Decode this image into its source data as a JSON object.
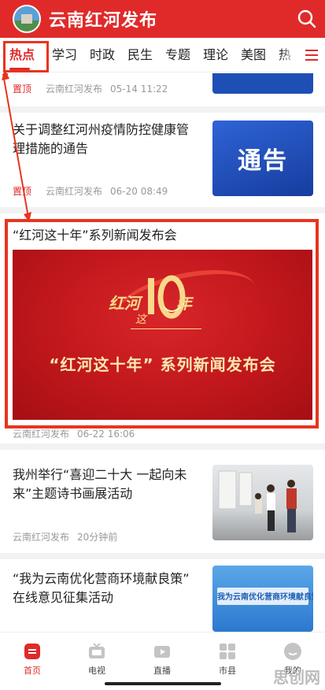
{
  "header": {
    "title": "云南红河发布",
    "logo_icon": "city-logo-icon",
    "search_icon": "search-icon",
    "color": "#e02a2a"
  },
  "tabs": {
    "items": [
      {
        "label": "热点",
        "active": true
      },
      {
        "label": "学习"
      },
      {
        "label": "时政"
      },
      {
        "label": "民生"
      },
      {
        "label": "专题"
      },
      {
        "label": "理论"
      },
      {
        "label": "美图"
      },
      {
        "label": "热"
      }
    ],
    "menu_icon": "menu-icon"
  },
  "feed": {
    "items": [
      {
        "pin": "置顶",
        "source": "云南红河发布",
        "time": "05-14 11:22"
      },
      {
        "title_line1": "关于调整红河州疫情防控健康管",
        "title_line2": "理措施的通告",
        "thumb_text": "通告",
        "pin": "置顶",
        "source": "云南红河发布",
        "time": "06-20 08:49"
      },
      {
        "title": "“红河这十年”系列新闻发布会",
        "banner_a": "红河",
        "banner_b": "这",
        "banner_c": "年",
        "banner_headline": "“红河这十年” 系列新闻发布会",
        "source": "云南红河发布",
        "time": "06-22 16:06"
      },
      {
        "title_line1": "我州举行“喜迎二十大 一起向未",
        "title_line2": "来”主题诗书画展活动",
        "source": "云南红河发布",
        "time": "20分钟前"
      },
      {
        "title_line1": "“我为云南优化营商环境献良策”",
        "title_line2": "在线意见征集活动",
        "thumb_text": "我为云南优化营商环境献良策"
      }
    ]
  },
  "bottom_nav": {
    "items": [
      {
        "label": "首页",
        "icon": "home-icon",
        "active": true
      },
      {
        "label": "电视",
        "icon": "tv-icon"
      },
      {
        "label": "直播",
        "icon": "live-video-icon"
      },
      {
        "label": "市县",
        "icon": "grid-icon"
      },
      {
        "label": "我的",
        "icon": "profile-icon"
      }
    ]
  },
  "watermark": "思创网"
}
